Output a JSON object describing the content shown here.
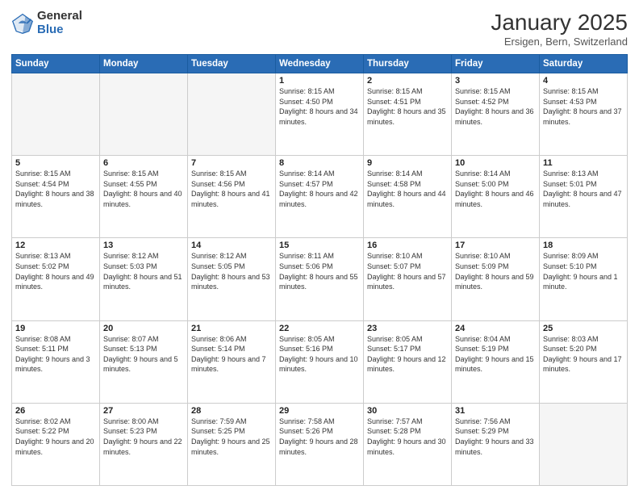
{
  "logo": {
    "general": "General",
    "blue": "Blue"
  },
  "header": {
    "month": "January 2025",
    "location": "Ersigen, Bern, Switzerland"
  },
  "weekdays": [
    "Sunday",
    "Monday",
    "Tuesday",
    "Wednesday",
    "Thursday",
    "Friday",
    "Saturday"
  ],
  "weeks": [
    [
      {
        "day": "",
        "empty": true
      },
      {
        "day": "",
        "empty": true
      },
      {
        "day": "",
        "empty": true
      },
      {
        "day": "1",
        "sunrise": "8:15 AM",
        "sunset": "4:50 PM",
        "daylight": "8 hours and 34 minutes."
      },
      {
        "day": "2",
        "sunrise": "8:15 AM",
        "sunset": "4:51 PM",
        "daylight": "8 hours and 35 minutes."
      },
      {
        "day": "3",
        "sunrise": "8:15 AM",
        "sunset": "4:52 PM",
        "daylight": "8 hours and 36 minutes."
      },
      {
        "day": "4",
        "sunrise": "8:15 AM",
        "sunset": "4:53 PM",
        "daylight": "8 hours and 37 minutes."
      }
    ],
    [
      {
        "day": "5",
        "sunrise": "8:15 AM",
        "sunset": "4:54 PM",
        "daylight": "8 hours and 38 minutes."
      },
      {
        "day": "6",
        "sunrise": "8:15 AM",
        "sunset": "4:55 PM",
        "daylight": "8 hours and 40 minutes."
      },
      {
        "day": "7",
        "sunrise": "8:15 AM",
        "sunset": "4:56 PM",
        "daylight": "8 hours and 41 minutes."
      },
      {
        "day": "8",
        "sunrise": "8:14 AM",
        "sunset": "4:57 PM",
        "daylight": "8 hours and 42 minutes."
      },
      {
        "day": "9",
        "sunrise": "8:14 AM",
        "sunset": "4:58 PM",
        "daylight": "8 hours and 44 minutes."
      },
      {
        "day": "10",
        "sunrise": "8:14 AM",
        "sunset": "5:00 PM",
        "daylight": "8 hours and 46 minutes."
      },
      {
        "day": "11",
        "sunrise": "8:13 AM",
        "sunset": "5:01 PM",
        "daylight": "8 hours and 47 minutes."
      }
    ],
    [
      {
        "day": "12",
        "sunrise": "8:13 AM",
        "sunset": "5:02 PM",
        "daylight": "8 hours and 49 minutes."
      },
      {
        "day": "13",
        "sunrise": "8:12 AM",
        "sunset": "5:03 PM",
        "daylight": "8 hours and 51 minutes."
      },
      {
        "day": "14",
        "sunrise": "8:12 AM",
        "sunset": "5:05 PM",
        "daylight": "8 hours and 53 minutes."
      },
      {
        "day": "15",
        "sunrise": "8:11 AM",
        "sunset": "5:06 PM",
        "daylight": "8 hours and 55 minutes."
      },
      {
        "day": "16",
        "sunrise": "8:10 AM",
        "sunset": "5:07 PM",
        "daylight": "8 hours and 57 minutes."
      },
      {
        "day": "17",
        "sunrise": "8:10 AM",
        "sunset": "5:09 PM",
        "daylight": "8 hours and 59 minutes."
      },
      {
        "day": "18",
        "sunrise": "8:09 AM",
        "sunset": "5:10 PM",
        "daylight": "9 hours and 1 minute."
      }
    ],
    [
      {
        "day": "19",
        "sunrise": "8:08 AM",
        "sunset": "5:11 PM",
        "daylight": "9 hours and 3 minutes."
      },
      {
        "day": "20",
        "sunrise": "8:07 AM",
        "sunset": "5:13 PM",
        "daylight": "9 hours and 5 minutes."
      },
      {
        "day": "21",
        "sunrise": "8:06 AM",
        "sunset": "5:14 PM",
        "daylight": "9 hours and 7 minutes."
      },
      {
        "day": "22",
        "sunrise": "8:05 AM",
        "sunset": "5:16 PM",
        "daylight": "9 hours and 10 minutes."
      },
      {
        "day": "23",
        "sunrise": "8:05 AM",
        "sunset": "5:17 PM",
        "daylight": "9 hours and 12 minutes."
      },
      {
        "day": "24",
        "sunrise": "8:04 AM",
        "sunset": "5:19 PM",
        "daylight": "9 hours and 15 minutes."
      },
      {
        "day": "25",
        "sunrise": "8:03 AM",
        "sunset": "5:20 PM",
        "daylight": "9 hours and 17 minutes."
      }
    ],
    [
      {
        "day": "26",
        "sunrise": "8:02 AM",
        "sunset": "5:22 PM",
        "daylight": "9 hours and 20 minutes."
      },
      {
        "day": "27",
        "sunrise": "8:00 AM",
        "sunset": "5:23 PM",
        "daylight": "9 hours and 22 minutes."
      },
      {
        "day": "28",
        "sunrise": "7:59 AM",
        "sunset": "5:25 PM",
        "daylight": "9 hours and 25 minutes."
      },
      {
        "day": "29",
        "sunrise": "7:58 AM",
        "sunset": "5:26 PM",
        "daylight": "9 hours and 28 minutes."
      },
      {
        "day": "30",
        "sunrise": "7:57 AM",
        "sunset": "5:28 PM",
        "daylight": "9 hours and 30 minutes."
      },
      {
        "day": "31",
        "sunrise": "7:56 AM",
        "sunset": "5:29 PM",
        "daylight": "9 hours and 33 minutes."
      },
      {
        "day": "",
        "empty": true
      }
    ]
  ],
  "labels": {
    "sunrise": "Sunrise:",
    "sunset": "Sunset:",
    "daylight": "Daylight:"
  }
}
